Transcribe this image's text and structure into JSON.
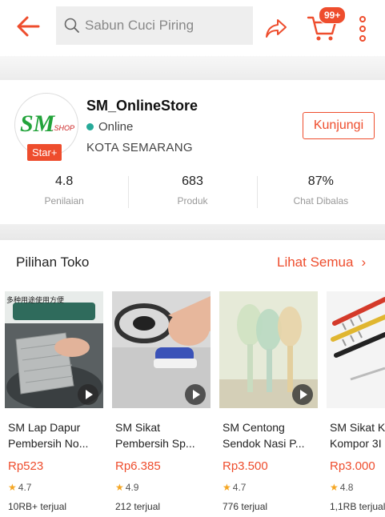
{
  "search": {
    "placeholder": "Sabun Cuci Piring"
  },
  "cart": {
    "badge": "99+"
  },
  "shop": {
    "logo_text": "SM",
    "logo_sub": ".SHOP",
    "star_badge": "Star+",
    "name": "SM_OnlineStore",
    "status": "Online",
    "city": "KOTA SEMARANG",
    "visit_label": "Kunjungi",
    "stats": [
      {
        "value": "4.8",
        "label": "Penilaian"
      },
      {
        "value": "683",
        "label": "Produk"
      },
      {
        "value": "87%",
        "label": "Chat Dibalas"
      }
    ]
  },
  "section": {
    "title": "Pilihan Toko",
    "see_all": "Lihat Semua",
    "chevron": "›"
  },
  "products": [
    {
      "line1": "SM Lap Dapur",
      "line2": "Pembersih No...",
      "price": "Rp523",
      "rating": "4.7",
      "sold": "10RB+ terjual",
      "img_caption": "多种用途使用方便"
    },
    {
      "line1": "SM Sikat",
      "line2": "Pembersih Sp...",
      "price": "Rp6.385",
      "rating": "4.9",
      "sold": "212 terjual"
    },
    {
      "line1": "SM Centong",
      "line2": "Sendok Nasi P...",
      "price": "Rp3.500",
      "rating": "4.7",
      "sold": "776 terjual"
    },
    {
      "line1": "SM Sikat K",
      "line2": "Kompor 3I",
      "price": "Rp3.000",
      "rating": "4.8",
      "sold": "1,1RB terjual"
    }
  ],
  "colors": {
    "accent": "#ee4d2d",
    "online": "#26aa99",
    "star": "#f5a623"
  },
  "icons": {
    "back": "arrow-left-icon",
    "search": "search-icon",
    "share": "share-icon",
    "cart": "cart-icon",
    "more": "more-vertical-icon",
    "play": "play-icon",
    "rating": "star-icon"
  }
}
